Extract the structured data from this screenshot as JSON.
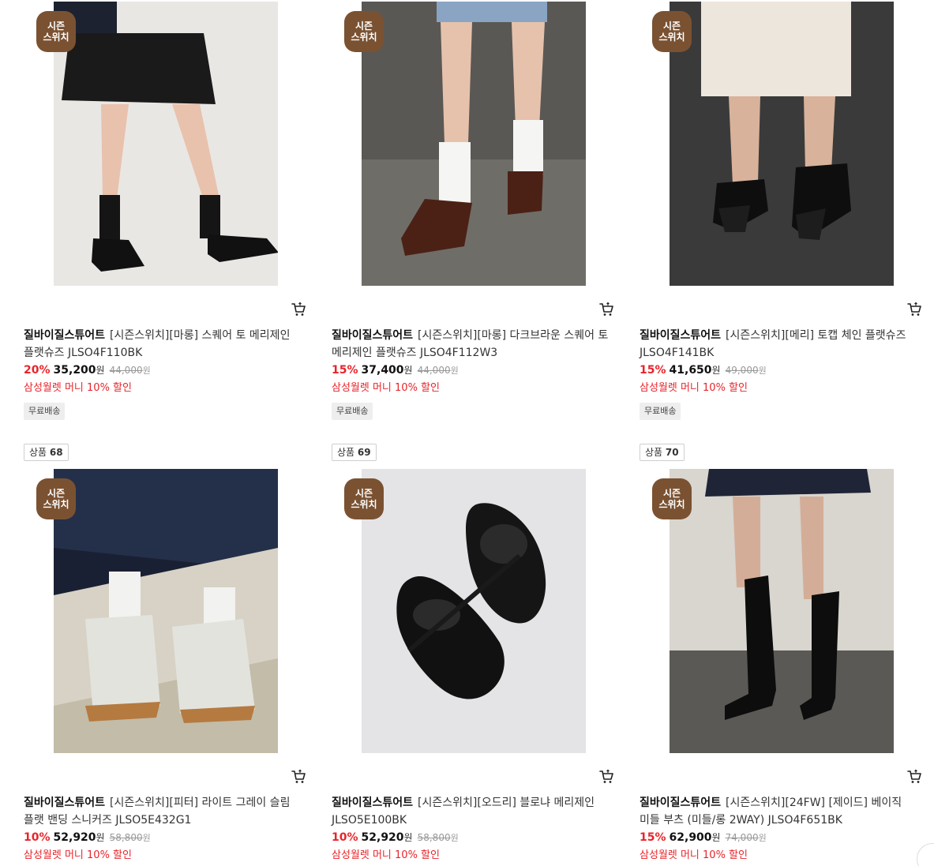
{
  "badge_text_line1": "시즌",
  "badge_text_line2": "스위치",
  "rank_prefix": "상품",
  "currency": "원",
  "products": [
    {
      "brand": "질바이질스튜어트",
      "name": "[시즌스위치][마롱] 스퀘어 토 메리제인 플랫슈즈 JLSO4F110BK",
      "discount": "20%",
      "price": "35,200",
      "original_price": "44,000",
      "benefit": "삼성월렛 머니 10% 할인",
      "tag": "무료배송"
    },
    {
      "brand": "질바이질스튜어트",
      "name": "[시즌스위치][마롱] 다크브라운 스퀘어 토 메리제인 플랫슈즈 JLSO4F112W3",
      "discount": "15%",
      "price": "37,400",
      "original_price": "44,000",
      "benefit": "삼성월렛 머니 10% 할인",
      "tag": "무료배송"
    },
    {
      "brand": "질바이질스튜어트",
      "name": "[시즌스위치][메리] 토캡 체인 플랫슈즈 JLSO4F141BK",
      "discount": "15%",
      "price": "41,650",
      "original_price": "49,000",
      "benefit": "삼성월렛 머니 10% 할인",
      "tag": "무료배송"
    },
    {
      "rank": "68",
      "brand": "질바이질스튜어트",
      "name": "[시즌스위치][피터] 라이트 그레이 슬림 플랫 밴딩 스니커즈 JLSO5E432G1",
      "discount": "10%",
      "price": "52,920",
      "original_price": "58,800",
      "benefit": "삼성월렛 머니 10% 할인"
    },
    {
      "rank": "69",
      "brand": "질바이질스튜어트",
      "name": "[시즌스위치][오드리] 블로냐 메리제인 JLSO5E100BK",
      "discount": "10%",
      "price": "52,920",
      "original_price": "58,800",
      "benefit": "삼성월렛 머니 10% 할인"
    },
    {
      "rank": "70",
      "brand": "질바이질스튜어트",
      "name": "[시즌스위치][24FW] [제이드] 베이직 미들 부츠 (미들/롱 2WAY) JLSO4F651BK",
      "discount": "15%",
      "price": "62,900",
      "original_price": "74,000",
      "benefit": "삼성월렛 머니 10% 할인"
    }
  ],
  "colors": {
    "discount": "#e8242a",
    "badge": "#7a5232"
  }
}
